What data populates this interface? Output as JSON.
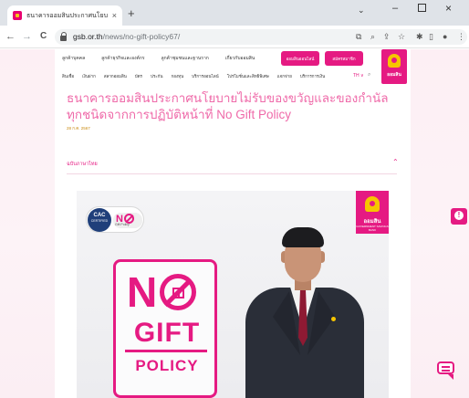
{
  "browser": {
    "tab_title": "ธนาคารออมสินประกาศนโยบายไม่รับฯ",
    "tab_close": "×",
    "new_tab": "+",
    "window_controls": {
      "chevron": "⌄",
      "minimize": "–",
      "close": "×"
    },
    "nav": {
      "back": "←",
      "forward": "→",
      "reload": "C"
    },
    "url_host": "gsb.or.th",
    "url_path": "/news/no-gift-policy67/",
    "toolbar_icons": [
      "translate-icon",
      "zoom-icon",
      "share-icon",
      "star-icon",
      "extensions-icon",
      "sidebar-icon",
      "profile-icon",
      "menu-icon"
    ]
  },
  "site": {
    "top_nav": [
      "ลูกค้าบุคคล",
      "ลูกค้าธุรกิจและองค์กร",
      "ลูกค้าชุมชนและฐานราก",
      "เกี่ยวกับออมสิน"
    ],
    "pill_buttons": [
      "ออมสินออนไลน์",
      "สมัครสมาชิก"
    ],
    "sub_nav": [
      "สินเชื่อ",
      "เงินฝาก",
      "สลากออมสิน",
      "บัตร",
      "ประกัน",
      "กองทุน",
      "บริการออนไลน์",
      "โปรโมชั่นและสิทธิพิเศษ",
      "แจกจ่าย",
      "บริการการเงิน"
    ],
    "lang_toggle": "TH ∨",
    "search_icon": "⌕",
    "logo_text": "ออมสิน",
    "headline": "ธนาคารออมสินประกาศนโยบายไม่รับของขวัญและของกำนัลทุกชนิดจากการปฏิบัติหน้าที่ No Gift Policy",
    "date": "28 ก.ค. 2567",
    "section_label": "ฉบับภาษาไทย",
    "section_chevron": "⌃"
  },
  "poster": {
    "cac_title": "CAC",
    "cac_sub": "CERTIFIED",
    "cac_n": "N",
    "cac_gift_policy": "Gift Policy",
    "logo_text": "ออมสิน",
    "logo_sub": "GOVERNMENT SAVINGS BANK",
    "big_n": "N",
    "big_gift": "GIFT",
    "big_policy": "POLICY"
  },
  "colors": {
    "brand_pink": "#e51a82",
    "headline_pink": "#ef6aa9",
    "gold": "#f6c500"
  }
}
